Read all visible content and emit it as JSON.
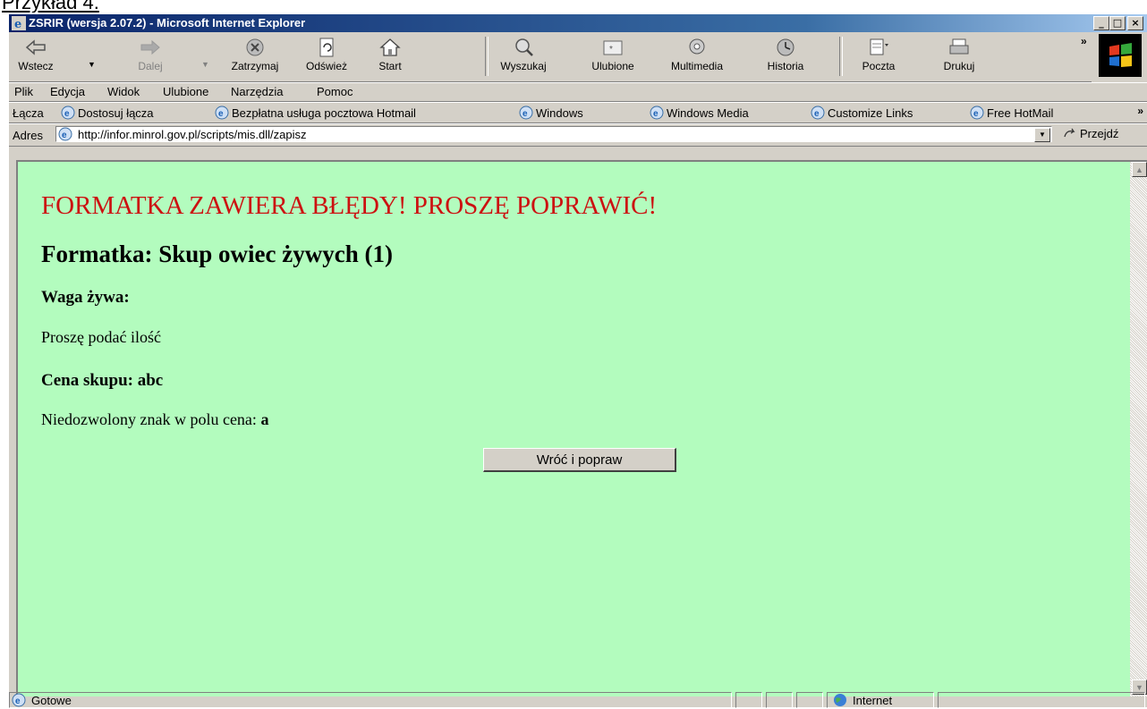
{
  "caption": "Przykład 4.",
  "window": {
    "title": "ZSRIR (wersja 2.07.2) - Microsoft Internet Explorer",
    "controls": {
      "minimize": "_",
      "maximize": "□",
      "close": "×"
    }
  },
  "toolbar": {
    "buttons": [
      {
        "label": "Wstecz",
        "icon": "back-arrow-icon",
        "enabled": true
      },
      {
        "label": "Dalej",
        "icon": "forward-arrow-icon",
        "enabled": false
      },
      {
        "label": "Zatrzymaj",
        "icon": "stop-icon",
        "enabled": true
      },
      {
        "label": "Odśwież",
        "icon": "refresh-icon",
        "enabled": true
      },
      {
        "label": "Start",
        "icon": "home-icon",
        "enabled": true
      },
      {
        "label": "Wyszukaj",
        "icon": "search-icon",
        "enabled": true
      },
      {
        "label": "Ulubione",
        "icon": "favorites-icon",
        "enabled": true
      },
      {
        "label": "Multimedia",
        "icon": "media-icon",
        "enabled": true
      },
      {
        "label": "Historia",
        "icon": "history-icon",
        "enabled": true
      },
      {
        "label": "Poczta",
        "icon": "mail-icon",
        "enabled": true
      },
      {
        "label": "Drukuj",
        "icon": "print-icon",
        "enabled": true
      }
    ],
    "more": "»"
  },
  "menu": {
    "items": [
      "Plik",
      "Edycja",
      "Widok",
      "Ulubione",
      "Narzędzia",
      "Pomoc"
    ]
  },
  "links": {
    "label": "Łącza",
    "items": [
      "Dostosuj łącza",
      "Bezpłatna usługa pocztowa Hotmail",
      "Windows",
      "Windows Media",
      "Customize Links",
      "Free HotMail"
    ],
    "more": "»"
  },
  "address": {
    "label": "Adres",
    "url": "http://infor.minrol.gov.pl/scripts/mis.dll/zapisz",
    "go_label": "Przejdź"
  },
  "content": {
    "error_title": "FORMATKA ZAWIERA BŁĘDY! PROSZĘ POPRAWIĆ!",
    "form_title": "Formatka: Skup owiec żywych (1)",
    "field1_label": "Waga żywa:",
    "field1_error": "Proszę podać ilość",
    "field2_label": "Cena skupu: abc",
    "field2_error_text": "Niedozwolony znak w polu cena: ",
    "field2_error_char": "a",
    "back_button": "Wróć i popraw"
  },
  "status": {
    "text": "Gotowe",
    "zone": "Internet"
  },
  "colors": {
    "content_bg": "#b3fcbe",
    "error_red": "#cc1111",
    "titlebar": "#0a246a"
  }
}
